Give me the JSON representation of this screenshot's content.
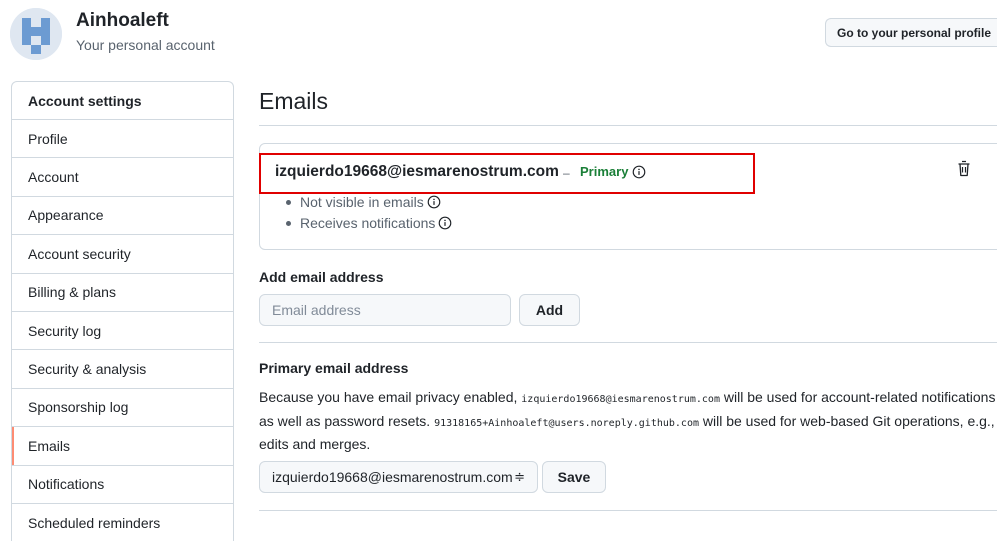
{
  "header": {
    "account_name": "Ainhoaleft",
    "account_subtitle": "Your personal account",
    "profile_button": "Go to your personal profile"
  },
  "sidebar": {
    "heading": "Account settings",
    "items": [
      {
        "label": "Profile"
      },
      {
        "label": "Account"
      },
      {
        "label": "Appearance"
      },
      {
        "label": "Account security"
      },
      {
        "label": "Billing & plans"
      },
      {
        "label": "Security log"
      },
      {
        "label": "Security & analysis"
      },
      {
        "label": "Sponsorship log"
      },
      {
        "label": "Emails",
        "selected": true
      },
      {
        "label": "Notifications"
      },
      {
        "label": "Scheduled reminders"
      }
    ]
  },
  "main": {
    "title": "Emails",
    "primary_email": {
      "address": "izquierdo19668@iesmarenostrum.com",
      "separator": "–",
      "badge": "Primary",
      "bullets": [
        "Not visible in emails",
        "Receives notifications"
      ]
    },
    "add_email": {
      "heading": "Add email address",
      "placeholder": "Email address",
      "button": "Add"
    },
    "primary_select": {
      "heading": "Primary email address",
      "text_1": "Because you have email privacy enabled, ",
      "code_1": "izquierdo19668@iesmarenostrum.com",
      "text_2": " will be used for account-related notifications as well as password resets. ",
      "code_2": "91318165+Ainhoaleft@users.noreply.github.com",
      "text_3": " will be used for web-based Git operations, e.g., edits and merges.",
      "selected_value": "izquierdo19668@iesmarenostrum.com",
      "select_arrow": "≑",
      "save_button": "Save"
    }
  },
  "colors": {
    "primary_badge": "#1a7f37",
    "highlight_border": "#e00000",
    "selected_indicator": "#fd8c73"
  }
}
